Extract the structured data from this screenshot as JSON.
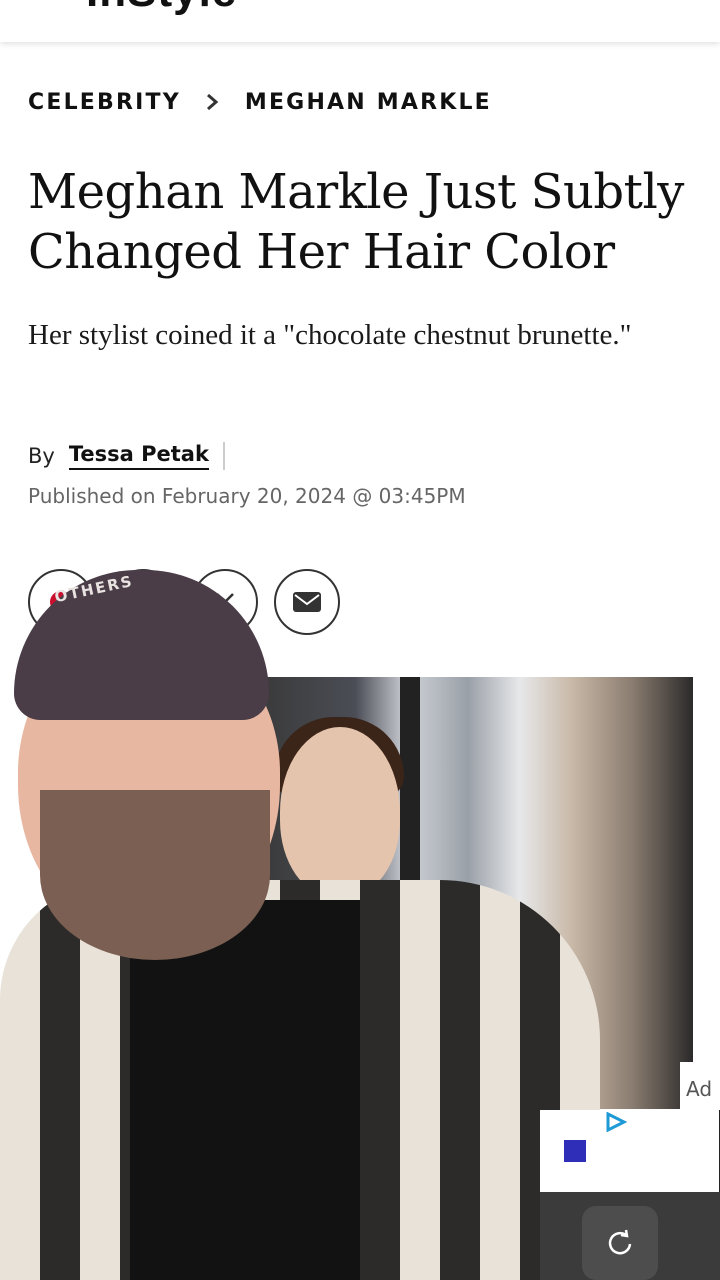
{
  "header": {
    "brand": "InStyle",
    "menu_icon": "hamburger-menu-icon"
  },
  "breadcrumb": {
    "items": [
      "CELEBRITY",
      "MEGHAN MARKLE"
    ],
    "separator_icon": "chevron-right-icon"
  },
  "article": {
    "headline": "Meghan Markle Just Subtly Changed Her Hair Color",
    "subheadline": "Her stylist coined it a \"chocolate chestnut brunette.\"",
    "byline_prefix": "By",
    "author": "Tessa Petak",
    "published": "Published on February 20, 2024 @ 03:45PM"
  },
  "share": {
    "buttons": [
      "pinterest-icon",
      "facebook-icon",
      "x-icon",
      "email-icon"
    ]
  },
  "overlay": {
    "cap_text": "OTHERS"
  },
  "ad": {
    "label": "Ad",
    "icon": "adchoices-icon"
  },
  "controls": {
    "refresh_icon": "refresh-icon"
  }
}
